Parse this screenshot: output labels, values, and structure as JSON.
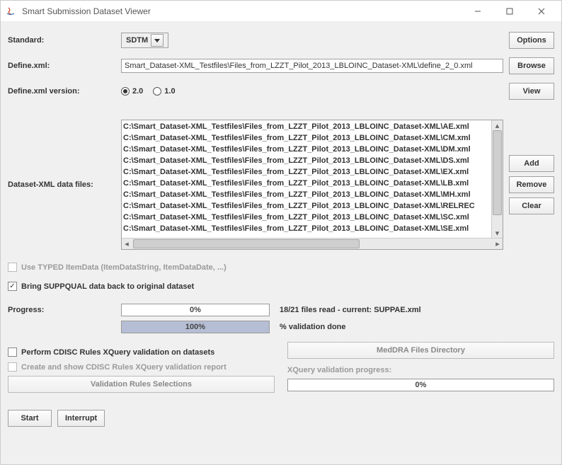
{
  "window": {
    "title": "Smart Submission Dataset Viewer"
  },
  "labels": {
    "standard": "Standard:",
    "definexml": "Define.xml:",
    "definexml_version": "Define.xml version:",
    "data_files": "Dataset-XML data files:",
    "progress": "Progress:"
  },
  "standard": {
    "selected": "SDTM"
  },
  "definexml_path": "Smart_Dataset-XML_Testfiles\\Files_from_LZZT_Pilot_2013_LBLOINC_Dataset-XML\\define_2_0.xml",
  "definexml_version": {
    "options": [
      "2.0",
      "1.0"
    ],
    "selected": "2.0"
  },
  "file_list": [
    "C:\\Smart_Dataset-XML_Testfiles\\Files_from_LZZT_Pilot_2013_LBLOINC_Dataset-XML\\AE.xml",
    "C:\\Smart_Dataset-XML_Testfiles\\Files_from_LZZT_Pilot_2013_LBLOINC_Dataset-XML\\CM.xml",
    "C:\\Smart_Dataset-XML_Testfiles\\Files_from_LZZT_Pilot_2013_LBLOINC_Dataset-XML\\DM.xml",
    "C:\\Smart_Dataset-XML_Testfiles\\Files_from_LZZT_Pilot_2013_LBLOINC_Dataset-XML\\DS.xml",
    "C:\\Smart_Dataset-XML_Testfiles\\Files_from_LZZT_Pilot_2013_LBLOINC_Dataset-XML\\EX.xml",
    "C:\\Smart_Dataset-XML_Testfiles\\Files_from_LZZT_Pilot_2013_LBLOINC_Dataset-XML\\LB.xml",
    "C:\\Smart_Dataset-XML_Testfiles\\Files_from_LZZT_Pilot_2013_LBLOINC_Dataset-XML\\MH.xml",
    "C:\\Smart_Dataset-XML_Testfiles\\Files_from_LZZT_Pilot_2013_LBLOINC_Dataset-XML\\RELREC",
    "C:\\Smart_Dataset-XML_Testfiles\\Files_from_LZZT_Pilot_2013_LBLOINC_Dataset-XML\\SC.xml",
    "C:\\Smart_Dataset-XML_Testfiles\\Files_from_LZZT_Pilot_2013_LBLOINC_Dataset-XML\\SE.xml"
  ],
  "buttons": {
    "options": "Options",
    "browse": "Browse",
    "view": "View",
    "add": "Add",
    "remove": "Remove",
    "clear": "Clear",
    "start": "Start",
    "interrupt": "Interrupt",
    "meddra": "MedDRA Files Directory",
    "validation_rules_selections": "Validation Rules Selections"
  },
  "checkboxes": {
    "use_typed": {
      "label": "Use TYPED ItemData (ItemDataString, ItemDataDate, ...)",
      "checked": false,
      "enabled": false
    },
    "bring_suppqual": {
      "label": "Bring SUPPQUAL data back to original dataset",
      "checked": true,
      "enabled": true
    },
    "perform_cdisc": {
      "label": "Perform CDISC Rules XQuery validation on datasets",
      "checked": false,
      "enabled": true
    },
    "create_report": {
      "label": "Create and show CDISC Rules XQuery validation report",
      "checked": false,
      "enabled": false
    }
  },
  "progress": {
    "read": {
      "percent": 0,
      "text": "0%",
      "status": "18/21 files read - current: SUPPAE.xml"
    },
    "validation": {
      "percent": 100,
      "text": "100%",
      "status": "% validation done"
    },
    "xquery": {
      "percent": 0,
      "text": "0%",
      "label": "XQuery validation progress:"
    }
  }
}
